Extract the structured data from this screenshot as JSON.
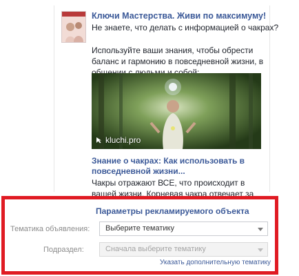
{
  "ad": {
    "title": "Ключи Мастерства. Живи по максимуму!",
    "lead": "Не знаете, что делать с информацией о чакрах?",
    "body": "Используйте ваши знания, чтобы обрести баланс и гармонию в повседневной жизни, в общении с людьми и собой:",
    "image_domain": "kluchi.pro",
    "link_title": "Знание о чакрах: Как использовать в повседневной жизни...",
    "link_description": "Чакры отражают ВСЕ, что происходит в вашей жизни. Корневая чакра отвечает за ваши финансы и здоровье..."
  },
  "params": {
    "title": "Параметры рекламируемого объекта",
    "topic_label": "Тематика объявления:",
    "topic_value": "Выберите тематику",
    "subsection_label": "Подраздел:",
    "subsection_value": "Сначала выберите тематику",
    "extra_topic_link": "Указать дополнительную тематику"
  },
  "colors": {
    "link_blue": "#3b5998",
    "highlight_red": "#e01b23"
  },
  "icons": {
    "domain": "link-arrow-icon",
    "select_arrow": "chevron-down-icon"
  }
}
